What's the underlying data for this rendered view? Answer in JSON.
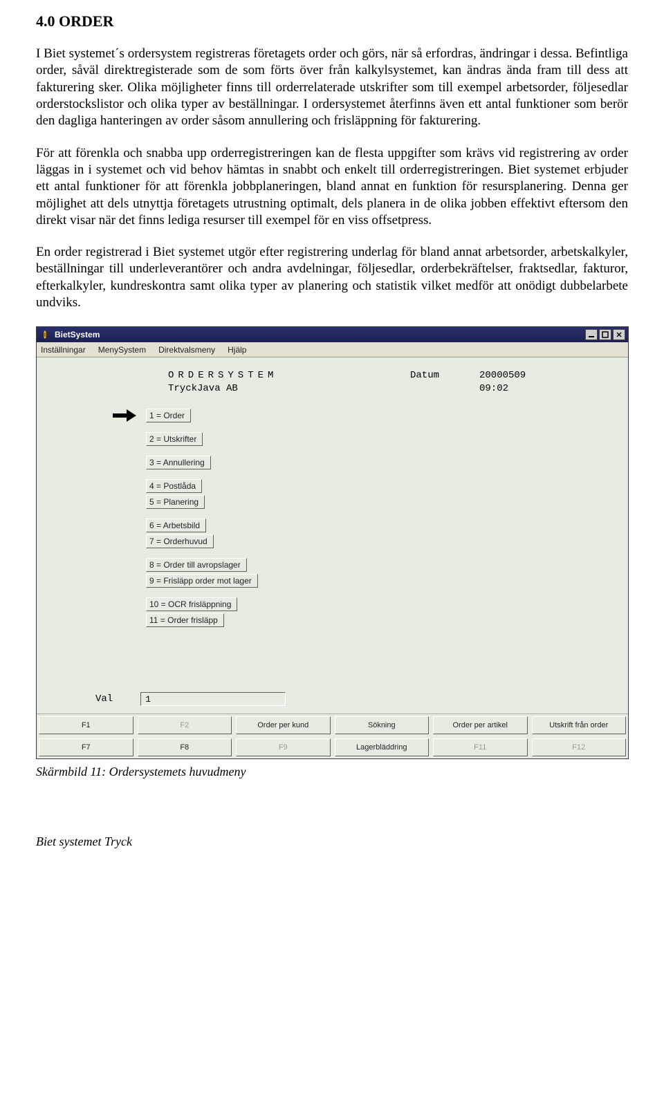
{
  "doc": {
    "heading": "4.0 ORDER",
    "para1": "I Biet systemet´s ordersystem registreras företagets order och görs, när så erfordras, ändringar i dessa. Befintliga order, såväl direktregisterade som de som förts över från kalkylsystemet, kan ändras ända fram till dess att fakturering sker. Olika möjligheter finns till orderrelaterade utskrifter som till exempel arbetsorder, följesedlar orderstockslistor och olika typer av beställningar. I ordersystemet återfinns även ett antal funktioner som berör den dagliga hanteringen av order såsom annullering och frisläppning för fakturering.",
    "para2": "För att förenkla och snabba upp orderregistreringen kan de flesta uppgifter som krävs vid registrering av order läggas in i systemet och vid behov hämtas in snabbt och enkelt till orderregistreringen. Biet systemet erbjuder ett antal funktioner för att förenkla jobbplaneringen, bland annat en funktion för resursplanering. Denna ger möjlighet att dels utnyttja företagets utrustning optimalt, dels planera in de olika jobben effektivt eftersom den direkt visar när det finns lediga resurser till exempel för en viss offsetpress.",
    "para3": "En order registrerad i Biet systemet utgör efter registrering underlag för bland annat arbetsorder, arbetskalkyler, beställningar till underleverantörer och andra avdelningar, följesedlar, orderbekräftelser, fraktsedlar, fakturor, efterkalkyler, kundreskontra samt olika typer av planering och statistik vilket medför att onödigt dubbelarbete undviks.",
    "caption": "Skärmbild 11: Ordersystemets huvudmeny",
    "footer": "Biet systemet Tryck"
  },
  "app": {
    "title": "BietSystem",
    "menubar": [
      "Inställningar",
      "MenySystem",
      "Direktvalsmeny",
      "Hjälp"
    ],
    "header_title": "ORDERSYSTEM",
    "date_label": "Datum",
    "date_value": "20000509",
    "company": "TryckJava AB",
    "time": "09:02",
    "menu_groups": [
      [
        "1 = Order"
      ],
      [
        "2 = Utskrifter"
      ],
      [
        "3 = Annullering"
      ],
      [
        "4 = Postlåda",
        "5 = Planering"
      ],
      [
        "6 = Arbetsbild",
        "7 = Orderhuvud"
      ],
      [
        "8 = Order till avropslager",
        "9 = Frisläpp order mot lager"
      ],
      [
        "10 = OCR frisläppning",
        "11 = Order frisläpp"
      ]
    ],
    "val_label": "Val",
    "val_value": "1",
    "fkeys_row1": [
      {
        "t": "F1",
        "dim": false
      },
      {
        "t": "F2",
        "dim": true
      },
      {
        "t": "Order per kund",
        "dim": false
      },
      {
        "t": "Sökning",
        "dim": false
      },
      {
        "t": "Order per artikel",
        "dim": false
      },
      {
        "t": "Utskrift från order",
        "dim": false
      }
    ],
    "fkeys_row2": [
      {
        "t": "F7",
        "dim": false
      },
      {
        "t": "F8",
        "dim": false
      },
      {
        "t": "F9",
        "dim": true
      },
      {
        "t": "Lagerbläddring",
        "dim": false
      },
      {
        "t": "F11",
        "dim": true
      },
      {
        "t": "F12",
        "dim": true
      }
    ]
  }
}
